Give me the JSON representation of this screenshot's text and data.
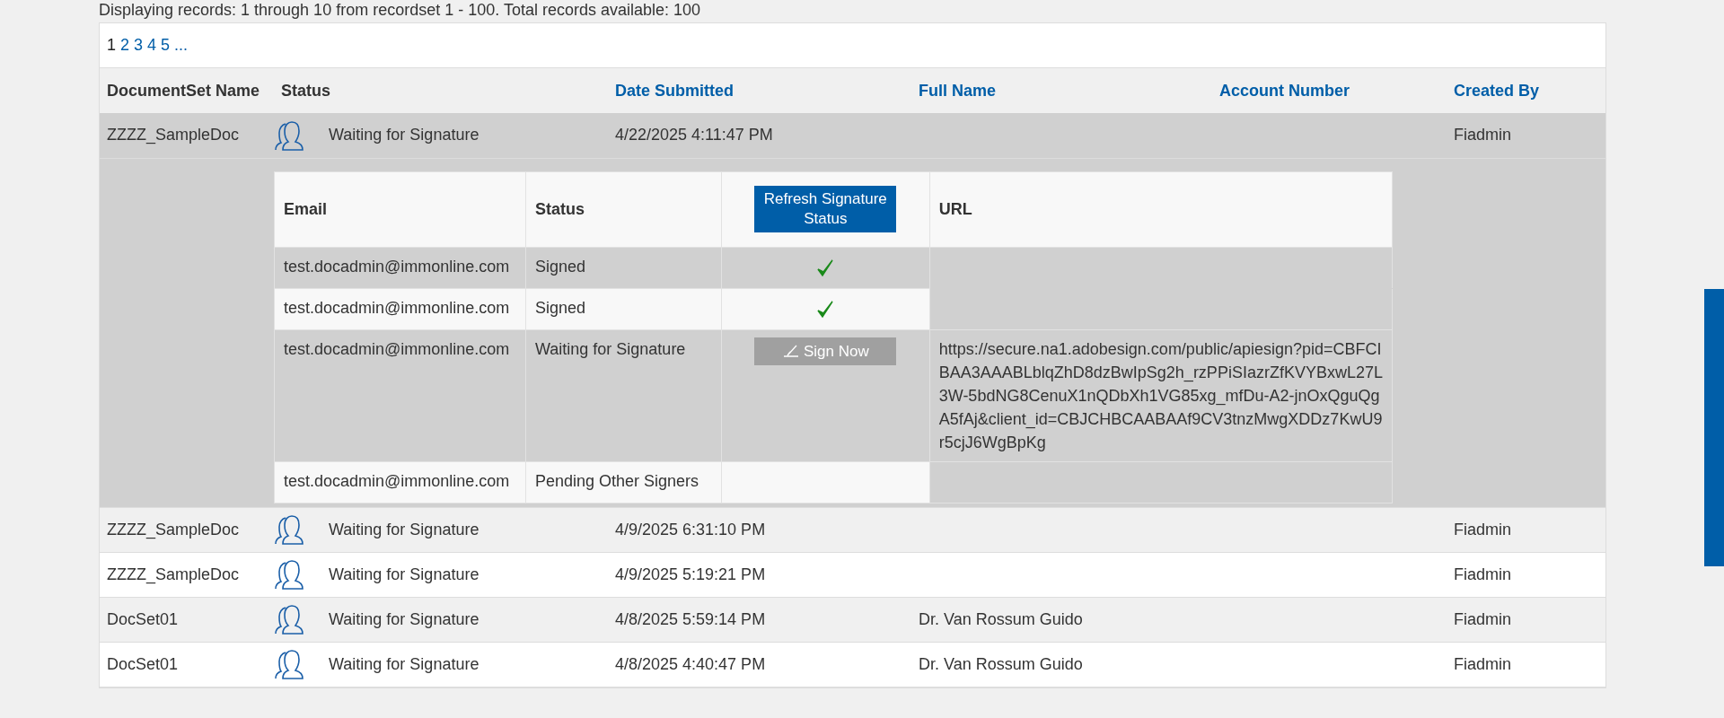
{
  "summary": "Displaying records: 1 through 10 from recordset 1 - 100. Total records available: 100",
  "pages": [
    {
      "label": "1",
      "selected": true
    },
    {
      "label": "2",
      "selected": false
    },
    {
      "label": "3",
      "selected": false
    },
    {
      "label": "4",
      "selected": false
    },
    {
      "label": "5",
      "selected": false
    },
    {
      "label": "...",
      "selected": false
    }
  ],
  "table": {
    "columns": [
      {
        "label": "DocumentSet Name",
        "sortable": false
      },
      {
        "label": "Status",
        "sortable": false
      },
      {
        "label": "Date Submitted",
        "sortable": true
      },
      {
        "label": "Full Name",
        "sortable": true
      },
      {
        "label": "Account Number",
        "sortable": true
      },
      {
        "label": "Created By",
        "sortable": true
      }
    ],
    "rows": [
      {
        "name": "ZZZZ_SampleDoc",
        "status": "Waiting for Signature",
        "date": "4/22/2025 4:11:47 PM",
        "full_name": "",
        "account": "",
        "created_by": "Fiadmin",
        "expanded": true,
        "signers": {
          "columns": [
            "Email",
            "Status",
            "URL"
          ],
          "refresh_button": "Refresh Signature Status",
          "rows": [
            {
              "email": "test.docadmin@immonline.com",
              "status": "Signed",
              "kind": "check"
            },
            {
              "email": "test.docadmin@immonline.com",
              "status": "Signed",
              "kind": "check"
            },
            {
              "email": "test.docadmin@immonline.com",
              "status": "Waiting for Signature",
              "kind": "sign",
              "button": "Sign Now",
              "url": "https://secure.na1.adobesign.com/public/apiesign?pid=CBFCIBAA3AAABLblqZhD8dzBwIpSg2h_rzPPiSIazrZfKVYBxwL27L3W-5bdNG8CenuX1nQDbXh1VG85xg_mfDu-A2-jnOxQguQgA5fAj&client_id=CBJCHBCAABAAf9CV3tnzMwgXDDz7KwU9r5cjJ6WgBpKg"
            },
            {
              "email": "test.docadmin@immonline.com",
              "status": "Pending Other Signers",
              "kind": "none"
            }
          ]
        }
      },
      {
        "name": "ZZZZ_SampleDoc",
        "status": "Waiting for Signature",
        "date": "4/9/2025 6:31:10 PM",
        "created_by": "Fiadmin",
        "expanded": false
      },
      {
        "name": "ZZZZ_SampleDoc",
        "status": "Waiting for Signature",
        "date": "4/9/2025 5:19:21 PM",
        "created_by": "Fiadmin",
        "expanded": false
      },
      {
        "name": "DocSet01",
        "status": "Waiting for Signature",
        "date": "4/8/2025 5:59:14 PM",
        "full_name": "Dr. Van Rossum Guido",
        "created_by": "Fiadmin",
        "expanded": false
      },
      {
        "name": "DocSet01",
        "status": "Waiting for Signature",
        "date": "4/8/2025 4:40:47 PM",
        "full_name": "Dr. Van Rossum Guido",
        "created_by": "Fiadmin",
        "expanded": false
      }
    ]
  }
}
